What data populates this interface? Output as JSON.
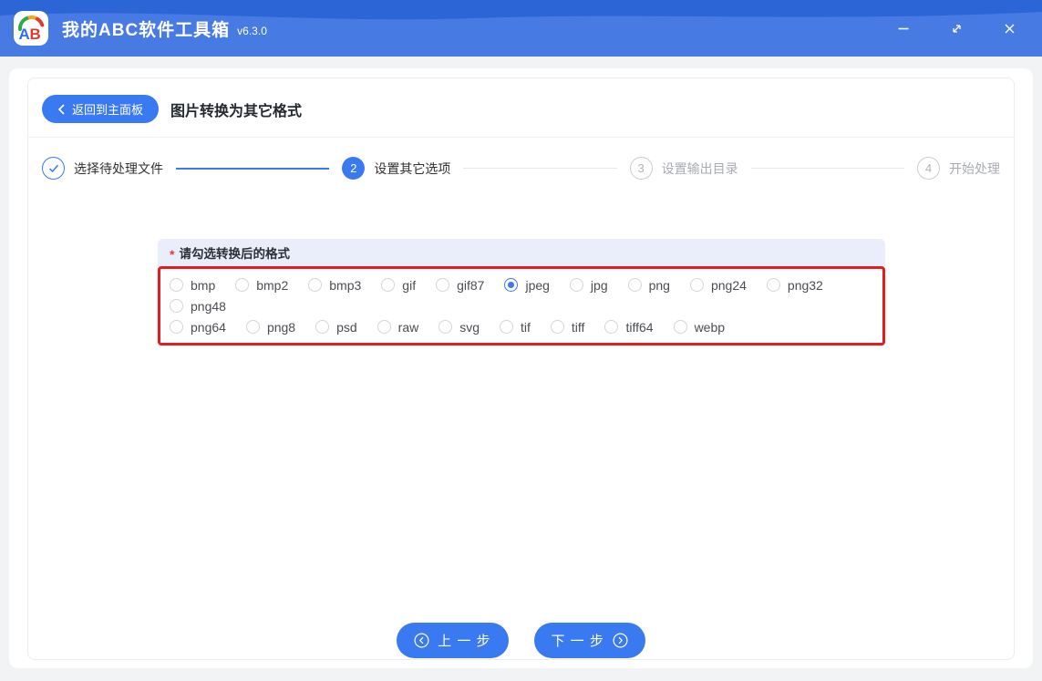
{
  "titlebar": {
    "title": "我的ABC软件工具箱",
    "version": "v6.3.0"
  },
  "header": {
    "back_label": "返回到主面板",
    "page_title": "图片转换为其它格式"
  },
  "stepper": {
    "steps": [
      {
        "number": "1",
        "label": "选择待处理文件",
        "state": "done"
      },
      {
        "number": "2",
        "label": "设置其它选项",
        "state": "active"
      },
      {
        "number": "3",
        "label": "设置输出目录",
        "state": "pending"
      },
      {
        "number": "4",
        "label": "开始处理",
        "state": "pending"
      }
    ]
  },
  "form": {
    "required_mark": "*",
    "label": "请勾选转换后的格式",
    "options": [
      "bmp",
      "bmp2",
      "bmp3",
      "gif",
      "gif87",
      "jpeg",
      "jpg",
      "png",
      "png24",
      "png32",
      "png48",
      "png64",
      "png8",
      "psd",
      "raw",
      "svg",
      "tif",
      "tiff",
      "tiff64",
      "webp"
    ],
    "selected": "jpeg",
    "wrap_after": "png48"
  },
  "footer": {
    "prev_label": "上 一 步",
    "next_label": "下 一 步"
  },
  "icons": {
    "logo": "AB-gauge-logo",
    "minimize": "minus",
    "maximize": "diagonal-resize-arrow",
    "close": "x-cross",
    "back": "chevron-left",
    "step_done": "check-circle",
    "prev": "circle-chevron-left",
    "next": "circle-chevron-right"
  },
  "colors": {
    "titlebar_top": "#2c66d6",
    "titlebar_wave": "#477ae3",
    "accent_blue": "#3a7af0",
    "highlight_red": "#e61c1c",
    "label_bar_bg": "#e9eefa",
    "page_bg": "#f2f3f5",
    "pending_gray": "#a8abb2"
  }
}
